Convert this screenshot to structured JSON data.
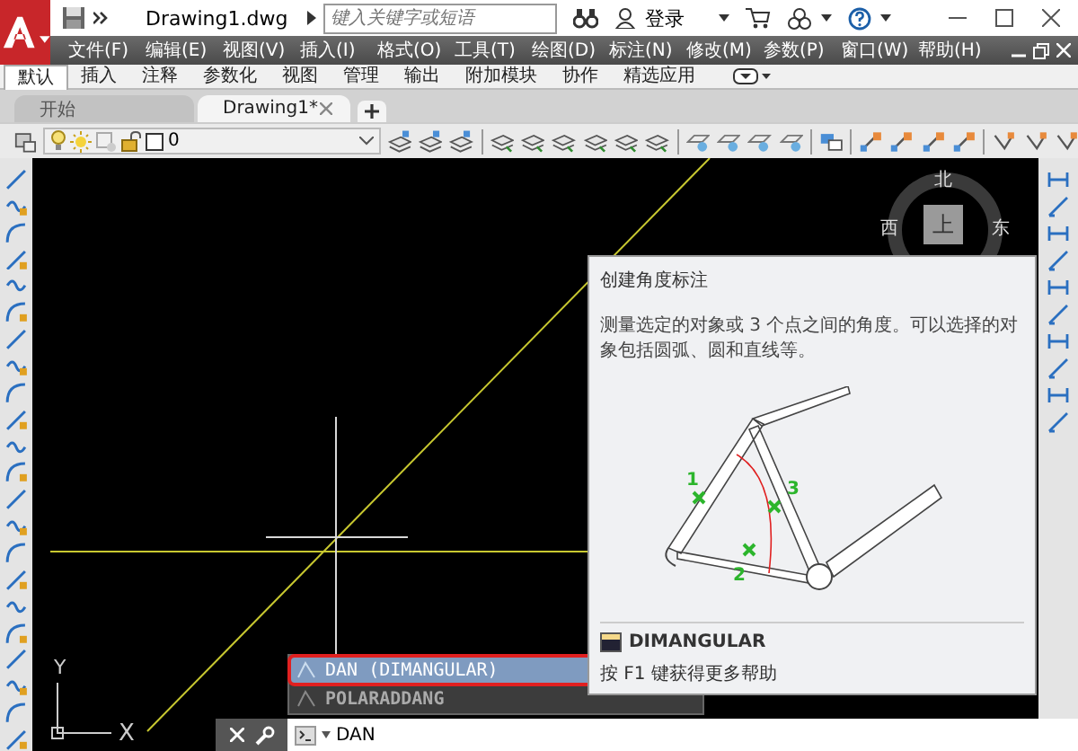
{
  "title_bar": {
    "title": "Drawing1.dwg",
    "search": {
      "placeholder": "键入关键字或短语"
    },
    "login": "登录"
  },
  "menu_bar": {
    "items": [
      "文件(F)",
      "编辑(E)",
      "视图(V)",
      "插入(I)",
      "格式(O)",
      "工具(T)",
      "绘图(D)",
      "标注(N)",
      "修改(M)",
      "参数(P)",
      "窗口(W)",
      "帮助(H)"
    ]
  },
  "ribbon_tabs": [
    {
      "label": "默认",
      "selected": true
    },
    {
      "label": "插入",
      "selected": false
    },
    {
      "label": "注释",
      "selected": false
    },
    {
      "label": "参数化",
      "selected": false
    },
    {
      "label": "视图",
      "selected": false
    },
    {
      "label": "管理",
      "selected": false
    },
    {
      "label": "输出",
      "selected": false
    },
    {
      "label": "附加模块",
      "selected": false
    },
    {
      "label": "协作",
      "selected": false
    },
    {
      "label": "精选应用",
      "selected": false
    }
  ],
  "doc_tabs": [
    {
      "label": "开始",
      "selected": false
    },
    {
      "label": "Drawing1*",
      "selected": true
    }
  ],
  "layer": {
    "name": "0"
  },
  "viewcube": {
    "north": "北",
    "west": "西",
    "east": "东",
    "top": "上"
  },
  "ucs": {
    "y": "Y",
    "x": "X"
  },
  "tooltip": {
    "title": "创建角度标注",
    "description": "测量选定的对象或 3 个点之间的角度。可以选择的对象包括圆弧、圆和直线等。",
    "points": [
      "1",
      "2",
      "3"
    ],
    "command": "DIMANGULAR",
    "help": "按 F1 键获得更多帮助"
  },
  "autocomplete": [
    {
      "label": "DAN (DIMANGULAR)",
      "selected": true
    },
    {
      "label": "POLARADDANG",
      "selected": false
    }
  ],
  "command_line": {
    "value": "DAN"
  }
}
